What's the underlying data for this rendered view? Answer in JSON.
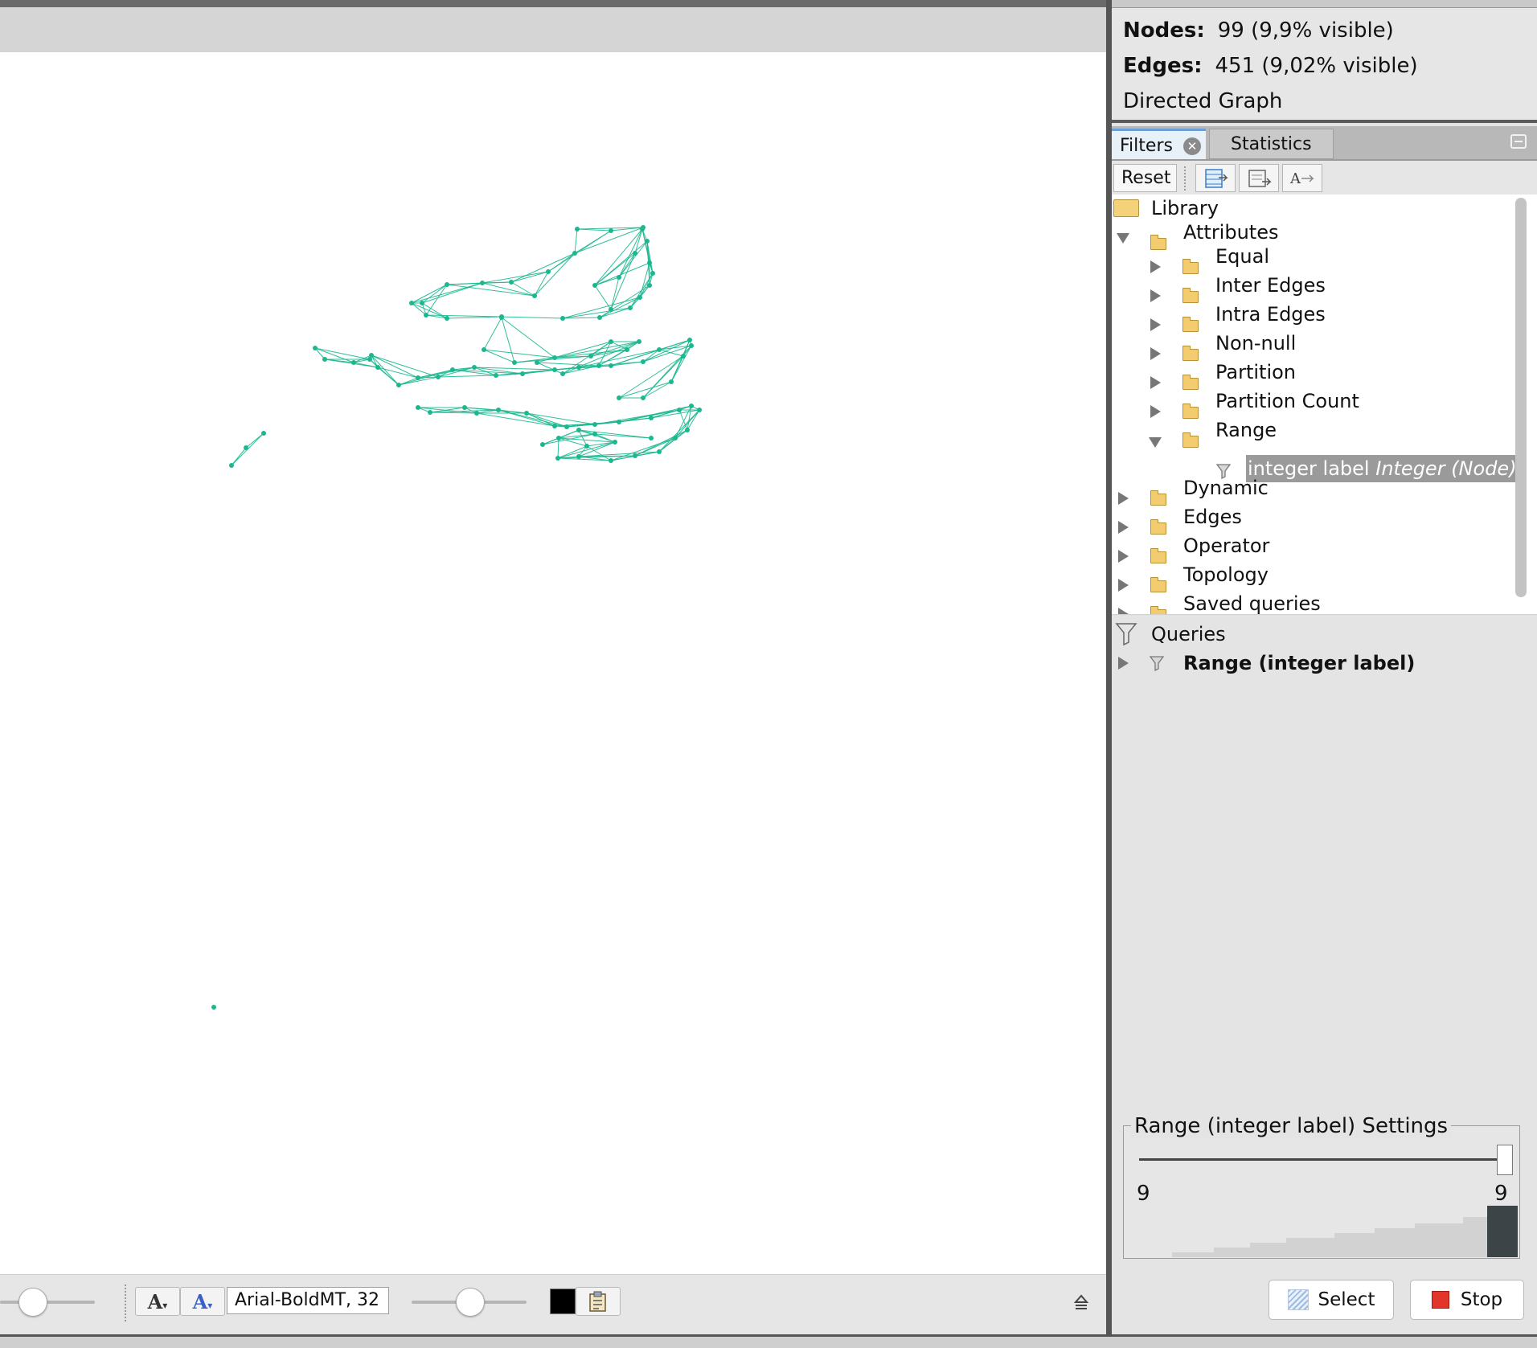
{
  "graph_info": {
    "nodes_label": "Nodes:",
    "nodes_value": "99 (9,9% visible)",
    "edges_label": "Edges:",
    "edges_value": "451 (9,02% visible)",
    "graph_type": "Directed Graph"
  },
  "tabs": {
    "filters": "Filters",
    "statistics": "Statistics"
  },
  "filter_toolbar": {
    "reset_label": "Reset"
  },
  "library_tree": {
    "root": "Library",
    "attributes": "Attributes",
    "attribute_children": [
      "Equal",
      "Inter Edges",
      "Intra Edges",
      "Non-null",
      "Partition",
      "Partition Count",
      "Range"
    ],
    "range_child_prefix": "integer label ",
    "range_child_type": "Integer (Node)",
    "top_level": [
      "Dynamic",
      "Edges",
      "Operator",
      "Topology"
    ],
    "truncated_item": "Saved queries"
  },
  "queries": {
    "label": "Queries",
    "items": [
      "Range (integer label)"
    ]
  },
  "settings": {
    "title": "Range (integer label) Settings",
    "min_value": "9",
    "max_value": "9",
    "slider_position": 1.0
  },
  "actions": {
    "select_label": "Select",
    "stop_label": "Stop"
  },
  "bottom_toolbar": {
    "font_value": "Arial-BoldMT, 32",
    "text_color": "#000000"
  },
  "colors": {
    "graph_edge": "#1bb78f",
    "panel_bg": "#e4e4e4",
    "tab_accent": "#6a9fd8",
    "stop_icon": "#e2362b"
  }
}
